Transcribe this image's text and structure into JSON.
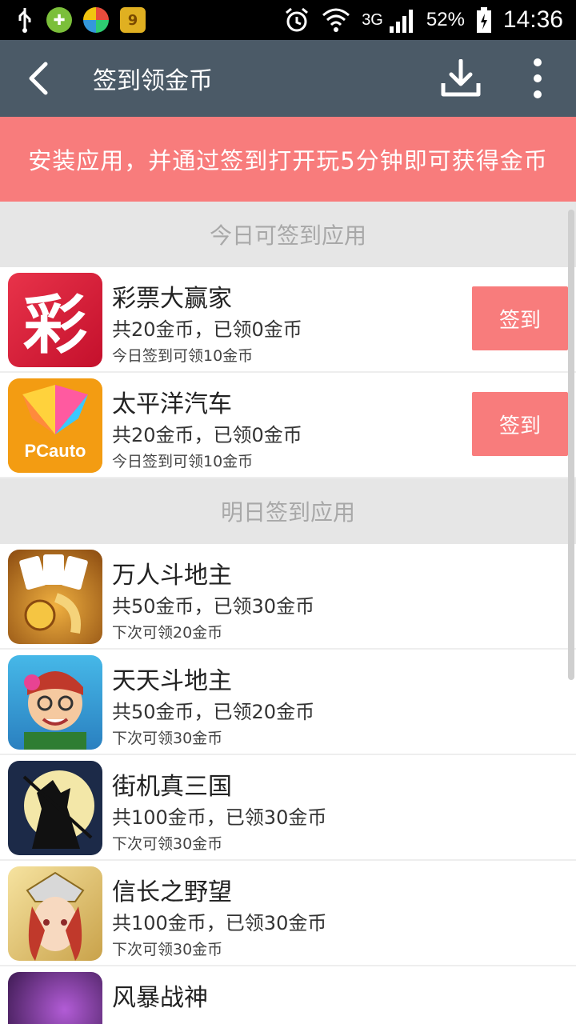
{
  "status_bar": {
    "network": "3G",
    "battery": "52%",
    "time": "14:36"
  },
  "header": {
    "title": "签到领金币"
  },
  "banner": {
    "text": "安装应用，并通过签到打开玩5分钟即可获得金币"
  },
  "sections": {
    "today": {
      "title": "今日可签到应用",
      "items": [
        {
          "name": "彩票大赢家",
          "coins": "共20金币，已领0金币",
          "hint": "今日签到可领10金币",
          "button": "签到",
          "icon_text": "彩"
        },
        {
          "name": "太平洋汽车",
          "coins": "共20金币，已领0金币",
          "hint": "今日签到可领10金币",
          "button": "签到",
          "icon_text": "PCauto"
        }
      ]
    },
    "tomorrow": {
      "title": "明日签到应用",
      "items": [
        {
          "name": "万人斗地主",
          "coins": "共50金币，已领30金币",
          "hint": "下次可领20金币"
        },
        {
          "name": "天天斗地主",
          "coins": "共50金币，已领20金币",
          "hint": "下次可领30金币"
        },
        {
          "name": "街机真三国",
          "coins": "共100金币，已领30金币",
          "hint": "下次可领30金币"
        },
        {
          "name": "信长之野望",
          "coins": "共100金币，已领30金币",
          "hint": "下次可领30金币"
        },
        {
          "name": "风暴战神",
          "coins": "",
          "hint": ""
        }
      ]
    }
  },
  "colors": {
    "accent": "#f87c7c",
    "actionbar": "#4b5a67",
    "section_bg": "#e6e6e6"
  }
}
